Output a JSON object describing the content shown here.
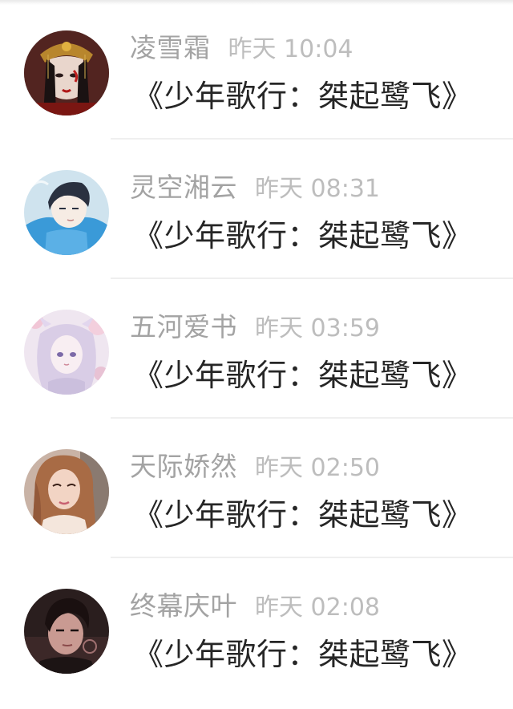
{
  "comments": [
    {
      "name": "凌雪霜",
      "time": "昨天 10:04",
      "text": "《少年歌行：桀起鹭飞》",
      "avatar": "avatar-woman-headdress"
    },
    {
      "name": "灵空湘云",
      "time": "昨天 08:31",
      "text": "《少年歌行：桀起鹭飞》",
      "avatar": "avatar-anime-boy"
    },
    {
      "name": "五河爱书",
      "time": "昨天 03:59",
      "text": "《少年歌行：桀起鹭飞》",
      "avatar": "avatar-anime-girl-lilac"
    },
    {
      "name": "天际娇然",
      "time": "昨天 02:50",
      "text": "《少年歌行：桀起鹭飞》",
      "avatar": "avatar-photo-woman"
    },
    {
      "name": "终幕庆叶",
      "time": "昨天 02:08",
      "text": "《少年歌行：桀起鹭飞》",
      "avatar": "avatar-dark-anime-boy"
    }
  ]
}
